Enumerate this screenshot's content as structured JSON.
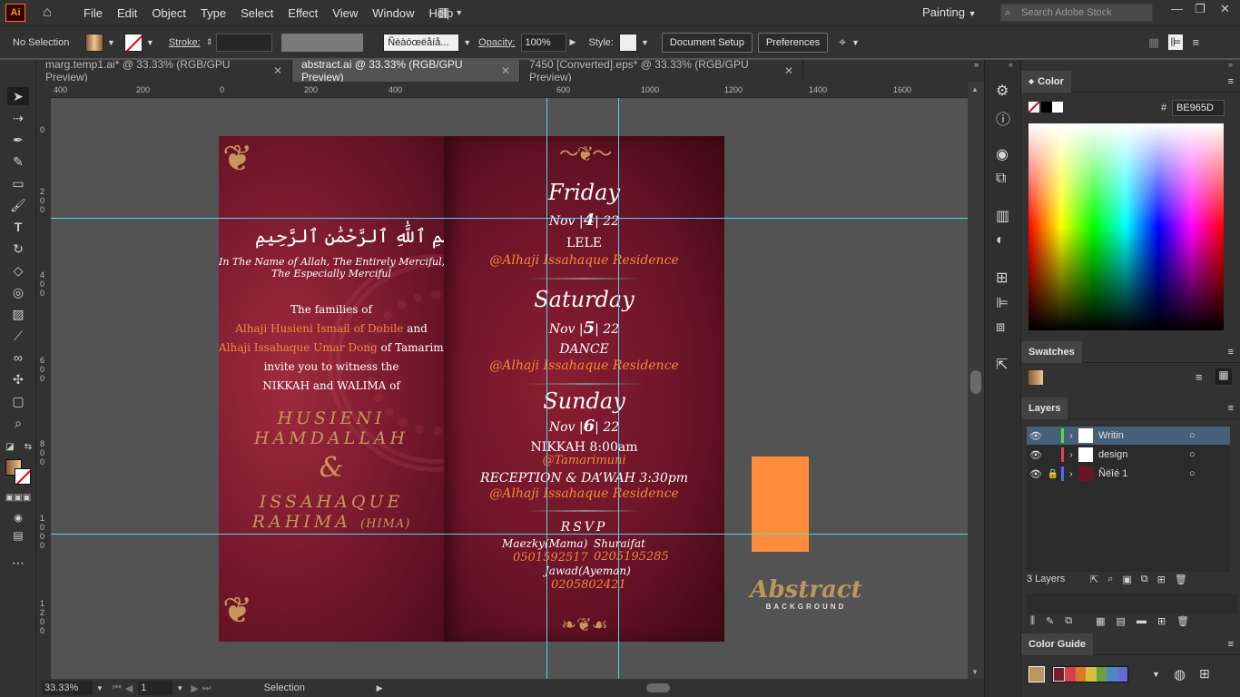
{
  "app": {
    "logo": "Ai",
    "workspace": "Painting",
    "search_placeholder": "Search Adobe Stock"
  },
  "menu": [
    "File",
    "Edit",
    "Object",
    "Type",
    "Select",
    "Effect",
    "View",
    "Window",
    "Help"
  ],
  "control": {
    "selection": "No Selection",
    "stroke_label": "Stroke:",
    "brush_label": "Ñèàóœëåíå...",
    "opacity_label": "Opacity:",
    "opacity_value": "100%",
    "style_label": "Style:",
    "document_setup": "Document Setup",
    "preferences": "Preferences"
  },
  "tabs": [
    {
      "label": "marg.temp1.ai* @ 33.33% (RGB/GPU Preview)",
      "close": "✕"
    },
    {
      "label": "abstract.ai @ 33.33% (RGB/GPU Preview)",
      "close": "✕"
    },
    {
      "label": "7450 [Converted].eps* @ 33.33% (RGB/GPU Preview)",
      "close": "✕"
    }
  ],
  "ruler_h": [
    "400",
    "200",
    "0",
    "200",
    "400",
    "600",
    "800",
    "1000",
    "1200",
    "1400",
    "1600"
  ],
  "ruler_v": [
    "0",
    "2\n0\n0",
    "4\n0\n0",
    "6\n0\n0",
    "8\n0\n0",
    "1\n0\n0\n0",
    "1\n2\n0\n0"
  ],
  "card_left": {
    "basmala": "بِسْمِ ٱللَّٰهِ ٱلرَّحْمَٰنِ ٱلرَّحِيمِ",
    "line1": "In The Name of Allah, The Entirely Merciful,",
    "line2": "The Especially Merciful",
    "families": "The families of",
    "family1": "Alhaji Husieni Ismail of Dobile",
    "and": "and",
    "family2": "Alhaji Issahaque Umar Dong",
    "of_tam": "of Tamarimuni",
    "invite": "invite you to witness the",
    "event": "NIKKAH and WALIMA of",
    "groom1": "HUSIENI",
    "groom2": "HAMDALLAH",
    "amp": "&",
    "bride1": "ISSAHAQUE",
    "bride2": "RAHIMA",
    "bride_nick": "(HIMA)"
  },
  "card_right": {
    "day1": "Friday",
    "d1_month": "Nov",
    "d1_date": "4",
    "d1_year": "22",
    "d1_event": "LELE",
    "d1_venue": "@Alhaji Issahaque Residence",
    "day2": "Saturday",
    "d2_month": "Nov",
    "d2_date": "5",
    "d2_year": "22",
    "d2_event": "DANCE",
    "d2_venue": "@Alhaji Issahaque Residence",
    "day3": "Sunday",
    "d3_month": "Nov",
    "d3_date": "6",
    "d3_year": "22",
    "nikkah": "NIKKAH 8:00am",
    "nikkah_venue": "@Tamarimuni",
    "reception": "RECEPTION & DA’WAH 3:30pm",
    "reception_venue": "@Alhaji Issahaque Residence",
    "rsvp": "RSVP",
    "c1_name": "Maezky(Mama)",
    "c1_phone": "0501592517",
    "c2_name": "Shuraifat",
    "c2_phone": "0205195285",
    "c3_name": "Jawad(Ayeman)",
    "c3_phone": "0205802421"
  },
  "abstract_logo": {
    "word": "Abstract",
    "sub": "BACKGROUND"
  },
  "status": {
    "zoom": "33.33%",
    "page": "1",
    "tool": "Selection"
  },
  "color_panel": {
    "title": "Color",
    "hex": "BE965D",
    "hash": "#"
  },
  "swatches_panel": {
    "title": "Swatches"
  },
  "layers_panel": {
    "title": "Layers",
    "layers": [
      {
        "name": "Writin",
        "color": "#4bdc4b",
        "selected": true,
        "locked": false
      },
      {
        "name": "design",
        "color": "#e64545",
        "selected": false,
        "locked": false
      },
      {
        "name": "Ñëîé 1",
        "color": "#4a6cff",
        "selected": false,
        "locked": true
      }
    ],
    "count": "3 Layers"
  },
  "color_guide": {
    "title": "Color Guide",
    "swatches": [
      "#7a1a2e",
      "#d6404e",
      "#d87a2a",
      "#d6c040",
      "#6aa040",
      "#4a88c8",
      "#6a6ad0"
    ]
  },
  "colors": {
    "accent_orange": "#ff8c3c",
    "gold": "#be965d",
    "guide": "#4bd8e6"
  }
}
